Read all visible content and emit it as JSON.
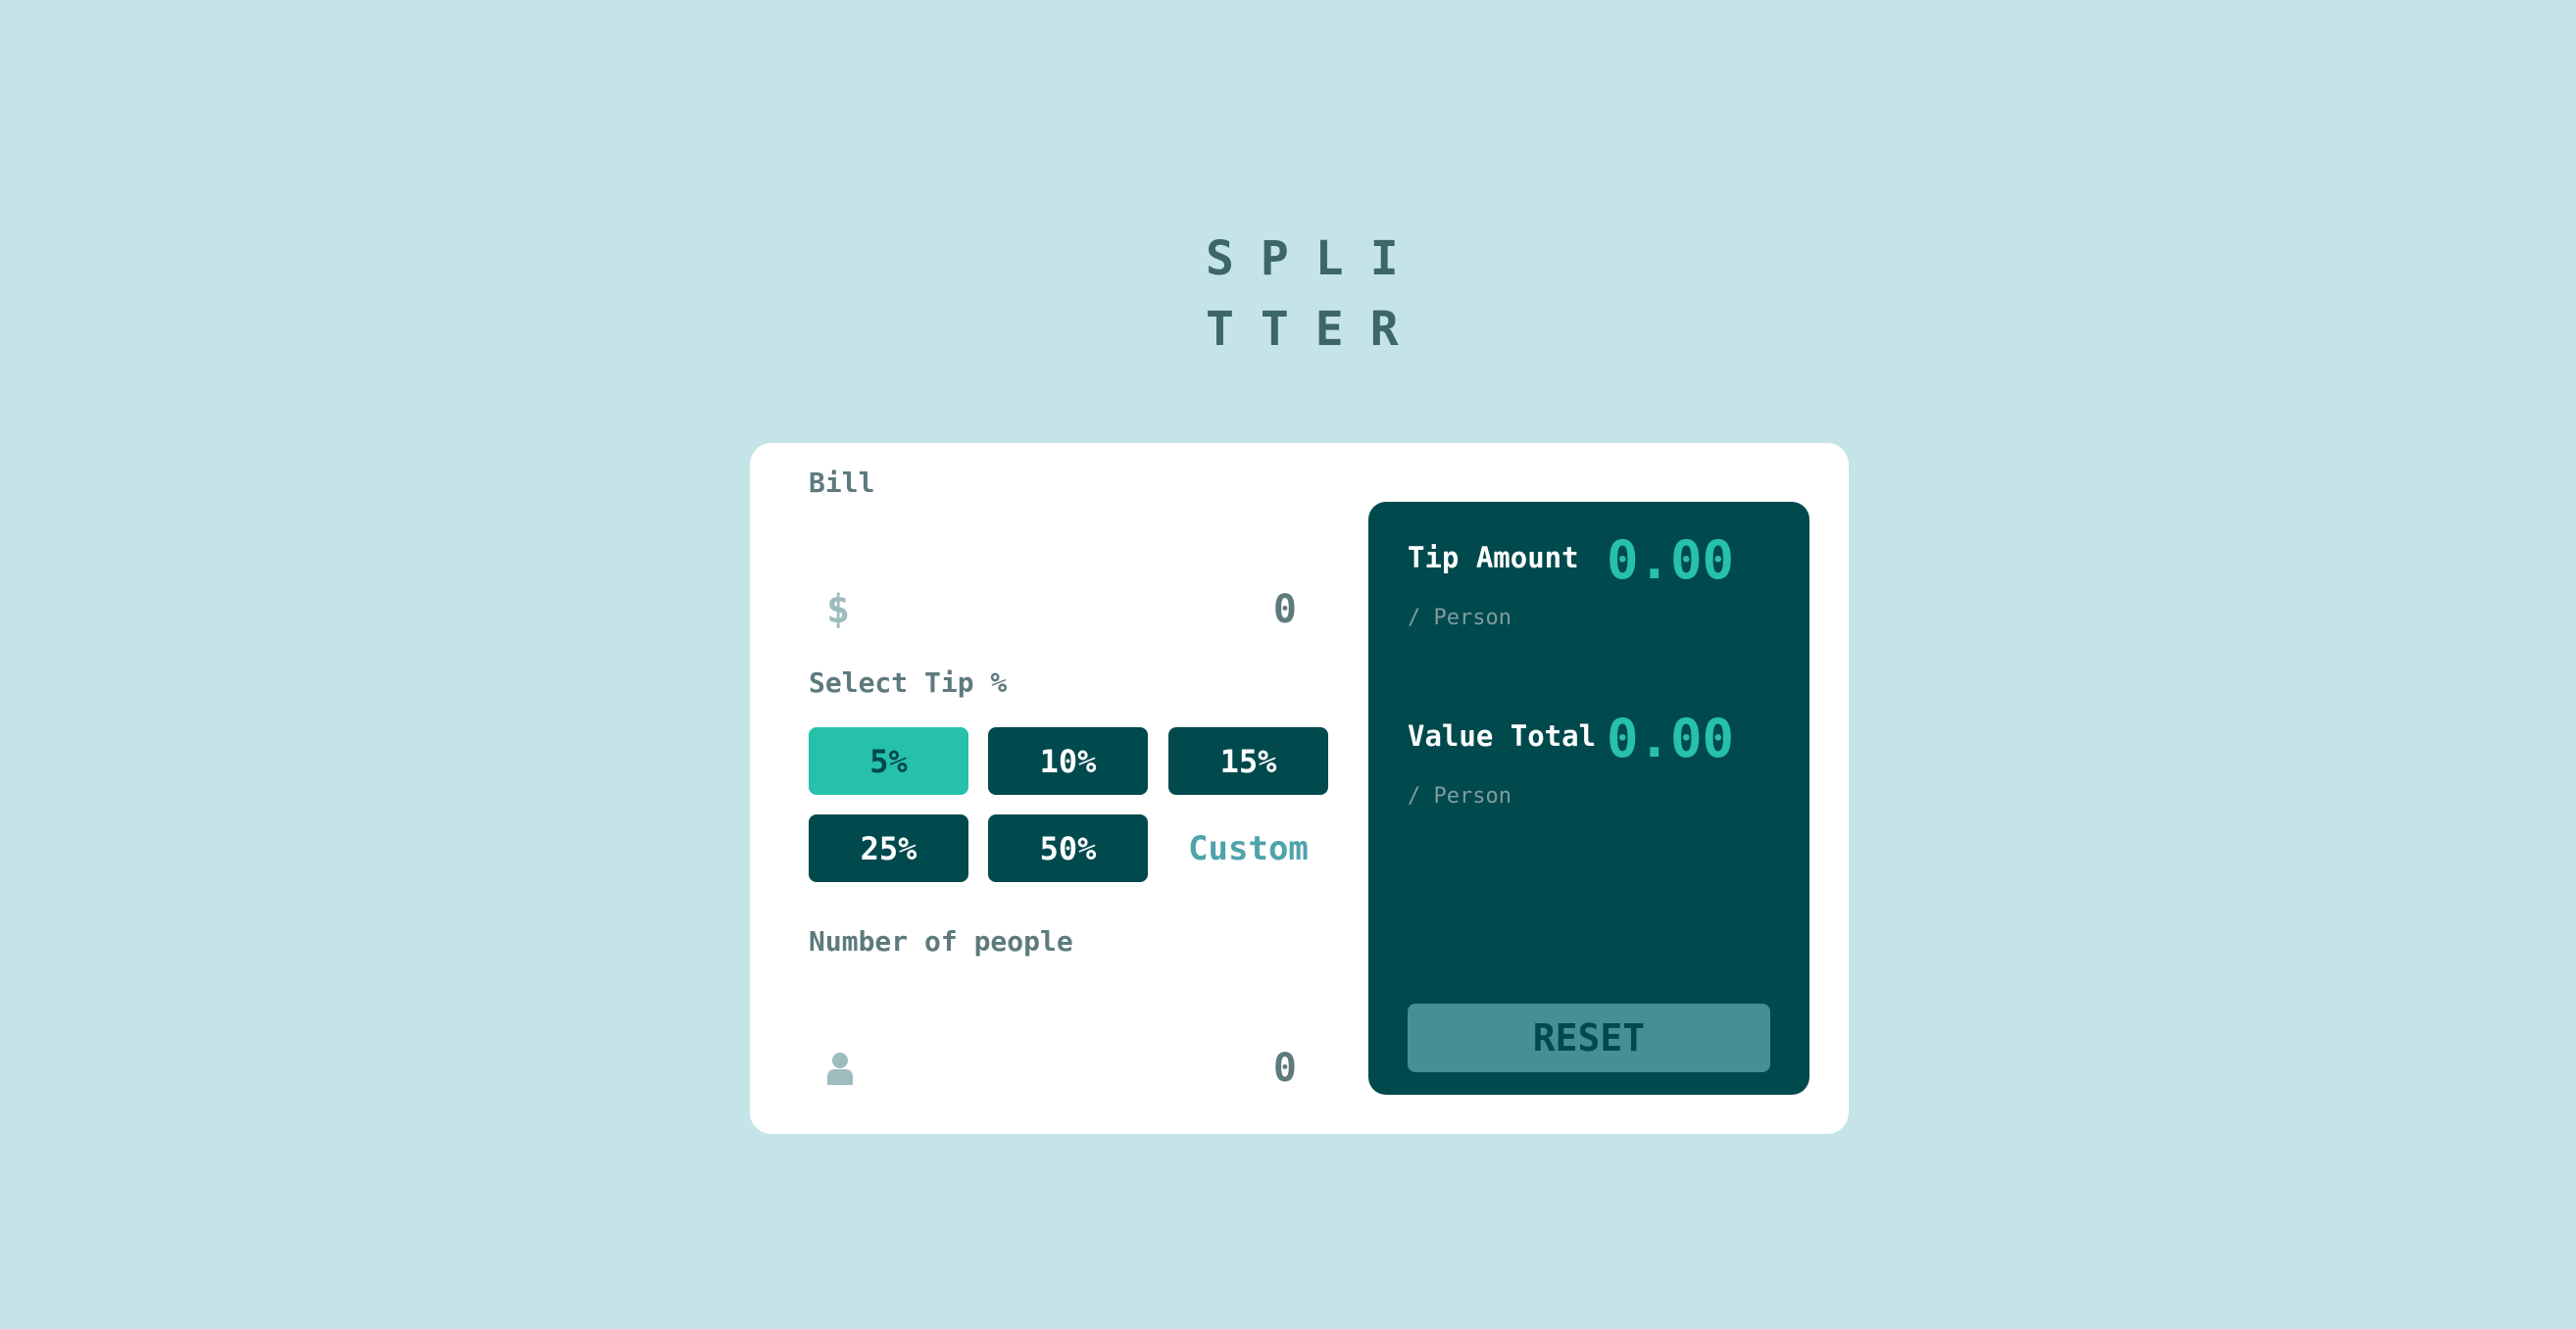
{
  "logo": {
    "line1": "SPLI",
    "line2": "TTER"
  },
  "bill": {
    "label": "Bill",
    "currency_icon": "dollar-icon",
    "currency_symbol": "$",
    "value": "0"
  },
  "tip": {
    "label": "Select Tip %",
    "options": [
      "5%",
      "10%",
      "15%",
      "25%",
      "50%"
    ],
    "selected": "5%",
    "custom_placeholder": "Custom"
  },
  "people": {
    "label": "Number of people",
    "icon": "person-icon",
    "value": "0"
  },
  "result": {
    "tip_amount_label": "Tip Amount",
    "tip_amount_sub": "/ Person",
    "tip_amount_value": "0.00",
    "total_label": "Value Total",
    "total_sub": "/ Person",
    "total_value": "0.00",
    "reset_label": "RESET"
  },
  "colors": {
    "background": "#c5e4e7",
    "card": "#ffffff",
    "dark_cyan": "#00494d",
    "accent": "#26c0ab",
    "reset_button": "#458f97"
  }
}
